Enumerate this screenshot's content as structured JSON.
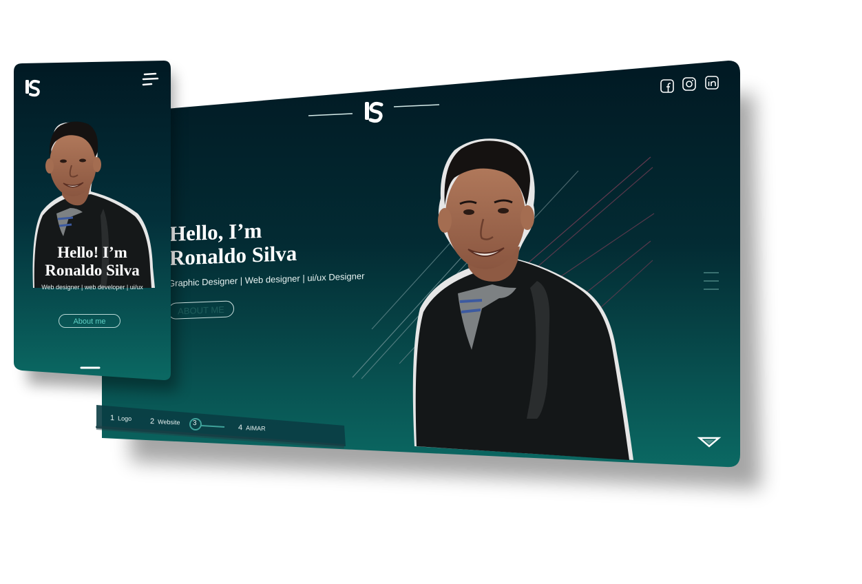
{
  "desktop": {
    "logo": "lS",
    "social": [
      "facebook-icon",
      "instagram-icon",
      "linkedin-icon"
    ],
    "hero": {
      "title_line1": "Hello, I’m",
      "title_line2": "Ronaldo Silva",
      "subtitle": "Graphic Designer | Web designer | ui/ux Designer",
      "cta": "ABOUT ME"
    },
    "nav": [
      {
        "num": "1",
        "label": "Logo"
      },
      {
        "num": "2",
        "label": "Website"
      },
      {
        "num": "3",
        "label": ""
      },
      {
        "num": "4",
        "label": "AIMAR"
      }
    ],
    "active_step": "3",
    "colors": {
      "bg_top": "#021a24",
      "bg_bottom": "#0b6662",
      "accent": "#3fa39b"
    }
  },
  "mobile": {
    "logo": "lS",
    "hero": {
      "title_line1": "Hello! I’m",
      "title_line2": "Ronaldo Silva",
      "subtitle": "Web designer | web developer | ui/ux",
      "cta": "About me"
    },
    "colors": {
      "bg_top": "#021a24",
      "bg_bottom": "#0b6662",
      "cta_text": "#5fd1c5"
    }
  }
}
